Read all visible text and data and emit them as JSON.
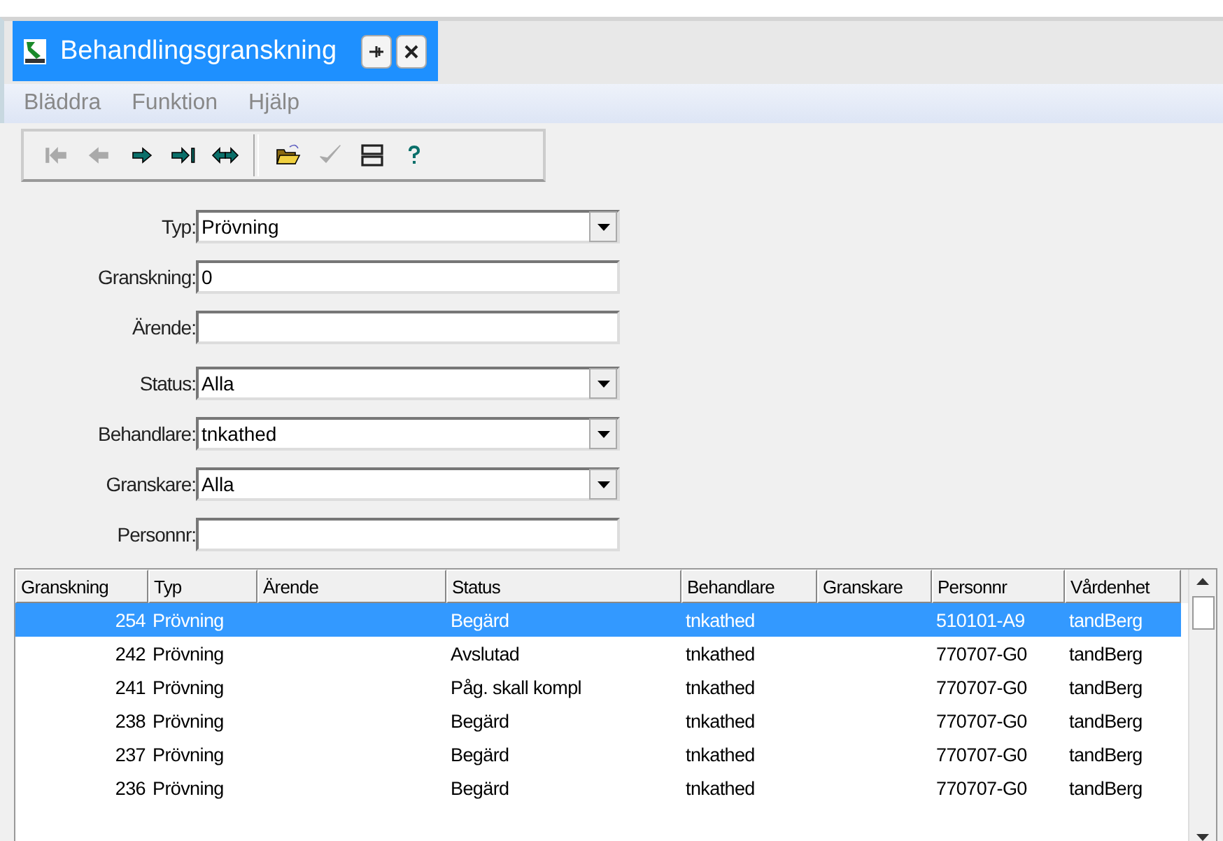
{
  "tab": {
    "title": "Behandlingsgranskning",
    "selected": true
  },
  "menu": [
    "Bläddra",
    "Funktion",
    "Hjälp"
  ],
  "toolbar": [
    {
      "kind": "first",
      "disabled": true
    },
    {
      "kind": "prev",
      "disabled": true
    },
    {
      "kind": "next",
      "disabled": false
    },
    {
      "kind": "last",
      "disabled": false
    },
    {
      "kind": "both",
      "disabled": false
    },
    {
      "kind": "open",
      "disabled": false
    },
    {
      "kind": "check",
      "disabled": true
    },
    {
      "kind": "split",
      "disabled": false
    },
    {
      "kind": "help",
      "disabled": false
    }
  ],
  "form": [
    {
      "label": "Typ:",
      "kind": "select",
      "value": "Prövning"
    },
    {
      "label": "Granskning:",
      "kind": "input",
      "value": "0"
    },
    {
      "label": "Ärende:",
      "kind": "input"
    },
    {
      "label": "Status:",
      "kind": "select",
      "value": "Alla"
    },
    {
      "label": "Behandlare:",
      "kind": "select",
      "value": "tnkathed"
    },
    {
      "label": "Granskare:",
      "kind": "select",
      "value": "Alla"
    },
    {
      "label": "Personnr:",
      "kind": "input"
    }
  ],
  "table": {
    "columns": [
      "Granskning",
      "Typ",
      "Ärende",
      "Status",
      "Behandlare",
      "Granskare",
      "Personnr",
      "Vårdenhet"
    ],
    "rows": [
      {
        "selected": true,
        "cells": [
          "254",
          "Prövning",
          "",
          "Begärd",
          "tnkathed",
          "",
          "510101-A9",
          "tandBerg"
        ]
      },
      {
        "selected": false,
        "cells": [
          "242",
          "Prövning",
          "",
          "Avslutad",
          "tnkathed",
          "",
          "770707-G0",
          "tandBerg"
        ]
      },
      {
        "selected": false,
        "cells": [
          "241",
          "Prövning",
          "",
          "Påg. skall kompl",
          "tnkathed",
          "",
          "770707-G0",
          "tandBerg"
        ]
      },
      {
        "selected": false,
        "cells": [
          "238",
          "Prövning",
          "",
          "Begärd",
          "tnkathed",
          "",
          "770707-G0",
          "tandBerg"
        ]
      },
      {
        "selected": false,
        "cells": [
          "237",
          "Prövning",
          "",
          "Begärd",
          "tnkathed",
          "",
          "770707-G0",
          "tandBerg"
        ]
      },
      {
        "selected": false,
        "cells": [
          "236",
          "Prövning",
          "",
          "Begärd",
          "tnkathed",
          "",
          "770707-G0",
          "tandBerg"
        ]
      }
    ]
  }
}
